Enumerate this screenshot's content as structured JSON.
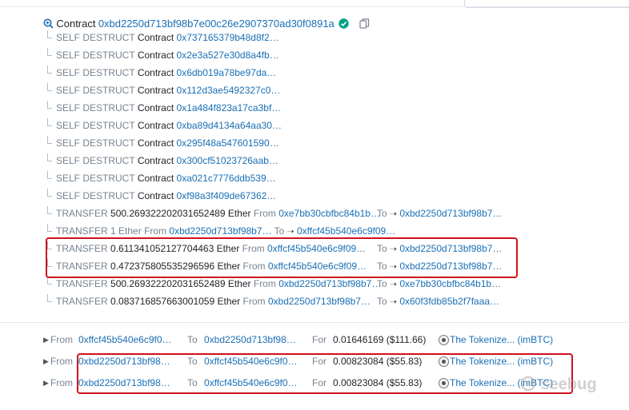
{
  "header": {
    "label": "Contract",
    "address": "0xbd2250d713bf98b7e00c26e2907370ad30f0891a"
  },
  "internal_txs": [
    {
      "type": "SELF DESTRUCT",
      "label": "Contract",
      "address": "0x737165379b48d8f2…"
    },
    {
      "type": "SELF DESTRUCT",
      "label": "Contract",
      "address": "0x2e3a527e30d8a4fb…"
    },
    {
      "type": "SELF DESTRUCT",
      "label": "Contract",
      "address": "0x6db019a78be97da…"
    },
    {
      "type": "SELF DESTRUCT",
      "label": "Contract",
      "address": "0x112d3ae5492327c0…"
    },
    {
      "type": "SELF DESTRUCT",
      "label": "Contract",
      "address": "0x1a484f823a17ca3bf…"
    },
    {
      "type": "SELF DESTRUCT",
      "label": "Contract",
      "address": "0xba89d4134a64aa30…"
    },
    {
      "type": "SELF DESTRUCT",
      "label": "Contract",
      "address": "0x295f48a547601590…"
    },
    {
      "type": "SELF DESTRUCT",
      "label": "Contract",
      "address": "0x300cf51023726aab…"
    },
    {
      "type": "SELF DESTRUCT",
      "label": "Contract",
      "address": "0xa021c7776ddb539…"
    },
    {
      "type": "SELF DESTRUCT",
      "label": "Contract",
      "address": "0xf98a3f409de67362…"
    }
  ],
  "transfers": [
    {
      "type": "TRANSFER",
      "amount": "500.269322202031652489 Ether",
      "from_label": "From",
      "from": "0xe7bb30cbfbc84b1b…",
      "to_label": "To",
      "to": "0xbd2250d713bf98b7…",
      "muted": false
    },
    {
      "type": "TRANSFER",
      "amount": "1 Ether",
      "from_label": "From",
      "from": "0xbd2250d713bf98b7…",
      "to_label": "To",
      "to": "0xffcf45b540e6c9f09…",
      "muted": true
    },
    {
      "type": "TRANSFER",
      "amount": "0.611341052127704463 Ether",
      "from_label": "From",
      "from": "0xffcf45b540e6c9f09…",
      "to_label": "To",
      "to": "0xbd2250d713bf98b7…",
      "muted": false
    },
    {
      "type": "TRANSFER",
      "amount": "0.472375805535296596 Ether",
      "from_label": "From",
      "from": "0xffcf45b540e6c9f09…",
      "to_label": "To",
      "to": "0xbd2250d713bf98b7…",
      "muted": false
    },
    {
      "type": "TRANSFER",
      "amount": "500.269322202031652489 Ether",
      "from_label": "From",
      "from": "0xbd2250d713bf98b7…",
      "to_label": "To",
      "to": "0xe7bb30cbfbc84b1b…",
      "muted": false
    },
    {
      "type": "TRANSFER",
      "amount": "0.083716857663001059 Ether",
      "from_label": "From",
      "from": "0xbd2250d713bf98b7…",
      "to_label": "To",
      "to": "0x60f3fdb85b2f7faaa…",
      "muted": false
    }
  ],
  "token_transfers": [
    {
      "from_label": "From",
      "from": "0xffcf45b540e6c9f0…",
      "to_label": "To",
      "to": "0xbd2250d713bf98…",
      "for_label": "For",
      "amount": "0.01646169 ($111.66)",
      "token": "The Tokenize... (imBTC)"
    },
    {
      "from_label": "From",
      "from": "0xbd2250d713bf98…",
      "to_label": "To",
      "to": "0xffcf45b540e6c9f0…",
      "for_label": "For",
      "amount": "0.00823084 ($55.83)",
      "token": "The Tokenize... (imBTC)"
    },
    {
      "from_label": "From",
      "from": "0xbd2250d713bf98…",
      "to_label": "To",
      "to": "0xffcf45b540e6c9f0…",
      "for_label": "For",
      "amount": "0.00823084 ($55.83)",
      "token": "The Tokenize... (imBTC)"
    }
  ],
  "icons": {
    "zoom": "magnifier-plus-icon",
    "verified": "check-circle-icon",
    "copy": "copy-icon",
    "arrow": "arrow-right",
    "caret": "caret-right",
    "token": "token-coin-icon"
  },
  "colors": {
    "link": "#1a6fb4",
    "highlight": "#d0101c",
    "verified": "#00a186",
    "muted": "#77838f"
  }
}
